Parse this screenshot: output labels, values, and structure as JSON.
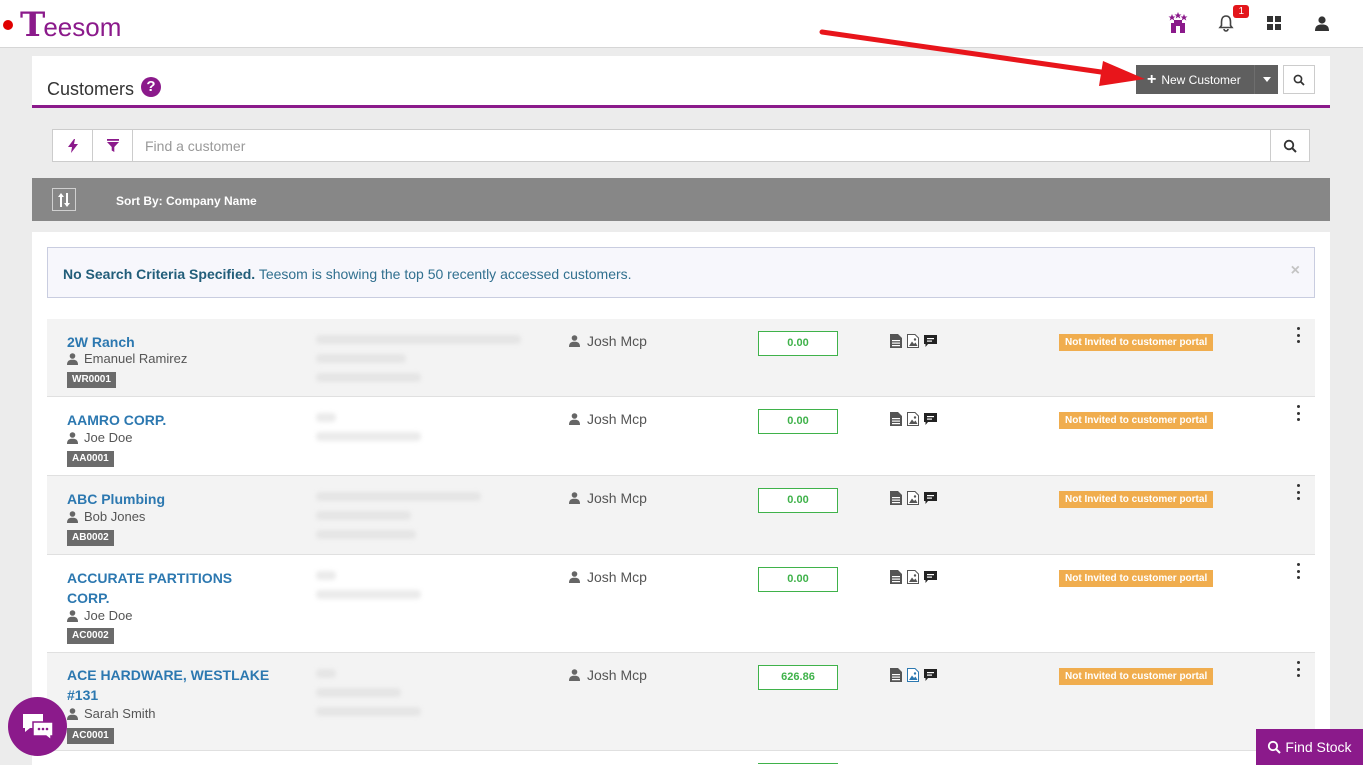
{
  "brand": {
    "name_initial": "T",
    "name_rest": "eesom"
  },
  "topbar": {
    "notification_count": "1"
  },
  "header": {
    "title": "Customers",
    "help_label": "?",
    "new_customer_label": "New Customer"
  },
  "search": {
    "placeholder": "Find a customer"
  },
  "sort": {
    "label": "Sort By: Company Name"
  },
  "alert": {
    "strong": "No Search Criteria Specified.",
    "text": " Teesom is showing the top 50 recently accessed customers.",
    "close": "×"
  },
  "customers": [
    {
      "name_line1": "2W Ranch",
      "name_line2": "",
      "contact": "Emanuel Ramirez",
      "code": "WR0001",
      "owner": "Josh Mcp",
      "balance": "0.00",
      "portal_status": "Not Invited to customer portal"
    },
    {
      "name_line1": "AAMRO CORP.",
      "name_line2": "",
      "contact": "Joe Doe",
      "code": "AA0001",
      "owner": "Josh Mcp",
      "balance": "0.00",
      "portal_status": "Not Invited to customer portal"
    },
    {
      "name_line1": "ABC Plumbing",
      "name_line2": "",
      "contact": "Bob Jones",
      "code": "AB0002",
      "owner": "Josh Mcp",
      "balance": "0.00",
      "portal_status": "Not Invited to customer portal"
    },
    {
      "name_line1": "ACCURATE PARTITIONS",
      "name_line2": "CORP.",
      "contact": "Joe Doe",
      "code": "AC0002",
      "owner": "Josh Mcp",
      "balance": "0.00",
      "portal_status": "Not Invited to customer portal"
    },
    {
      "name_line1": "ACE HARDWARE, WESTLAKE",
      "name_line2": "#131",
      "contact": "Sarah Smith",
      "code": "AC0001",
      "owner": "Josh Mcp",
      "balance": "626.86",
      "portal_status": "Not Invited to customer portal"
    }
  ],
  "find_stock": {
    "label": "Find Stock"
  },
  "colors": {
    "brand_purple": "#8b1a8b",
    "link_blue": "#2c78b0",
    "balance_green": "#3fb24a",
    "portal_orange": "#f0ad4e",
    "annotation_red": "#e8151b"
  }
}
